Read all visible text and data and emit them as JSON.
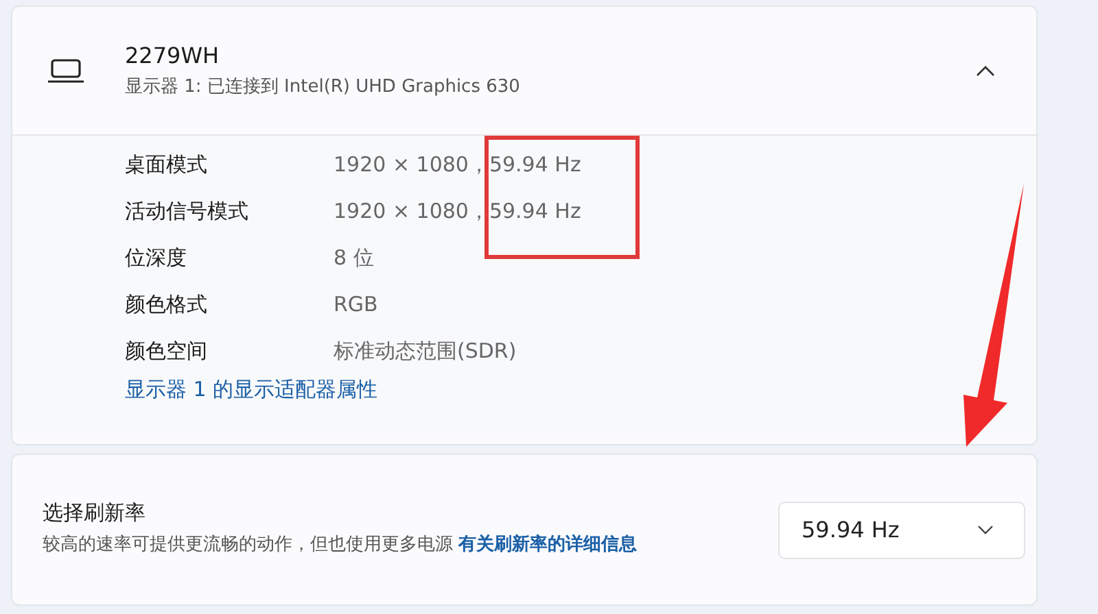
{
  "display": {
    "name": "2279WH",
    "subtitle": "显示器 1: 已连接到 Intel(R) UHD Graphics 630",
    "expanded": true,
    "properties": [
      {
        "label": "桌面模式",
        "value": "1920 × 1080，59.94 Hz"
      },
      {
        "label": "活动信号模式",
        "value": "1920 × 1080，59.94 Hz"
      },
      {
        "label": "位深度",
        "value": "8 位"
      },
      {
        "label": "颜色格式",
        "value": "RGB"
      },
      {
        "label": "颜色空间",
        "value": "标准动态范围(SDR)"
      }
    ],
    "adapter_link": "显示器 1 的显示适配器属性"
  },
  "refresh_rate": {
    "title": "选择刷新率",
    "description": "较高的速率可提供更流畅的动作，但也使用更多电源",
    "link": "有关刷新率的详细信息",
    "value": "59.94 Hz"
  }
}
